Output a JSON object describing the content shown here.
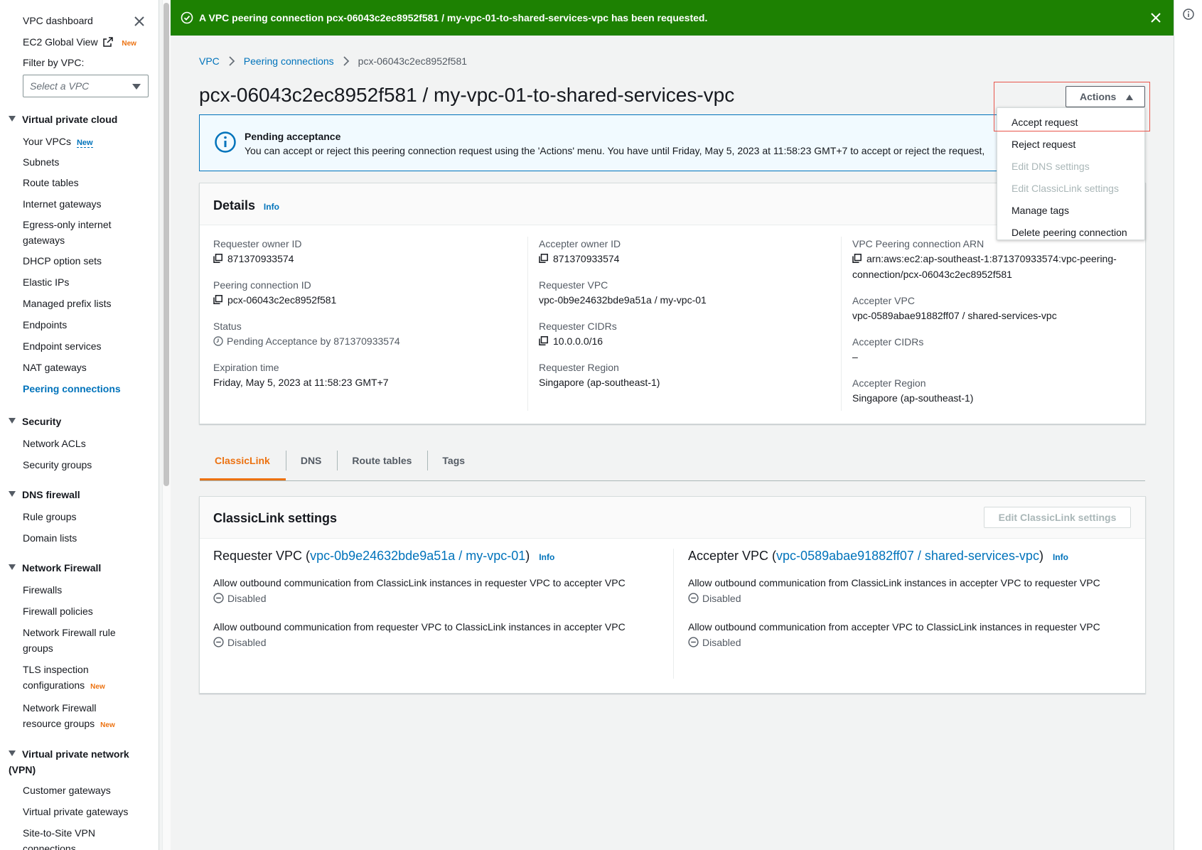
{
  "sidebar": {
    "dashboard": "VPC dashboard",
    "global_view": "EC2 Global View",
    "global_view_badge": "New",
    "filter_label": "Filter by VPC:",
    "filter_placeholder": "Select a VPC",
    "sections": [
      {
        "title": "Virtual private cloud",
        "items": [
          "Your VPCs",
          "Subnets",
          "Route tables",
          "Internet gateways",
          "Egress-only internet gateways",
          "DHCP option sets",
          "Elastic IPs",
          "Managed prefix lists",
          "Endpoints",
          "Endpoint services",
          "NAT gateways",
          "Peering connections"
        ]
      },
      {
        "title": "Security",
        "items": [
          "Network ACLs",
          "Security groups"
        ]
      },
      {
        "title": "DNS firewall",
        "items": [
          "Rule groups",
          "Domain lists"
        ]
      },
      {
        "title": "Network Firewall",
        "items": [
          "Firewalls",
          "Firewall policies",
          "Network Firewall rule groups",
          "TLS inspection configurations",
          "Network Firewall resource groups"
        ]
      },
      {
        "title": "Virtual private network (VPN)",
        "items": [
          "Customer gateways",
          "Virtual private gateways",
          "Site-to-Site VPN connections"
        ]
      }
    ],
    "your_vpcs_badge": "New",
    "tls_badge": "New",
    "resource_groups_badge": "New"
  },
  "flash": {
    "message": "A VPC peering connection pcx-06043c2ec8952f581 / my-vpc-01-to-shared-services-vpc has been requested.",
    "color": "#1d8102"
  },
  "breadcrumb": [
    "VPC",
    "Peering connections",
    "pcx-06043c2ec8952f581"
  ],
  "page_title": "pcx-06043c2ec8952f581 / my-vpc-01-to-shared-services-vpc",
  "actions": {
    "label": "Actions",
    "menu": [
      "Accept request",
      "Reject request",
      "Edit DNS settings",
      "Edit ClassicLink settings",
      "Manage tags",
      "Delete peering connection"
    ]
  },
  "alert": {
    "title": "Pending acceptance",
    "body": "You can accept or reject this peering connection request using the 'Actions' menu. You have until Friday, May 5, 2023 at 11:58:23 GMT+7 to accept or reject the request,"
  },
  "details": {
    "title": "Details",
    "info": "Info",
    "requester_owner_id_label": "Requester owner ID",
    "requester_owner_id": "871370933574",
    "peering_connection_id_label": "Peering connection ID",
    "peering_connection_id": "pcx-06043c2ec8952f581",
    "status_label": "Status",
    "status": "Pending Acceptance by 871370933574",
    "expiration_label": "Expiration time",
    "expiration": "Friday, May 5, 2023 at 11:58:23 GMT+7",
    "accepter_owner_id_label": "Accepter owner ID",
    "accepter_owner_id": "871370933574",
    "requester_vpc_label": "Requester VPC",
    "requester_vpc": "vpc-0b9e24632bde9a51a / my-vpc-01",
    "requester_cidrs_label": "Requester CIDRs",
    "requester_cidrs": "10.0.0.0/16",
    "requester_region_label": "Requester Region",
    "requester_region": "Singapore (ap-southeast-1)",
    "arn_label": "VPC Peering connection ARN",
    "arn_line1": "arn:aws:ec2:ap-southeast-1:871370933574:vpc-peering-",
    "arn_line2": "connection/pcx-06043c2ec8952f581",
    "accepter_vpc_label": "Accepter VPC",
    "accepter_vpc": "vpc-0589abae91882ff07 / shared-services-vpc",
    "accepter_cidrs_label": "Accepter CIDRs",
    "accepter_cidrs": "–",
    "accepter_region_label": "Accepter Region",
    "accepter_region": "Singapore (ap-southeast-1)"
  },
  "tabs": [
    "ClassicLink",
    "DNS",
    "Route tables",
    "Tags"
  ],
  "classiclink": {
    "title": "ClassicLink settings",
    "edit_button": "Edit ClassicLink settings",
    "requester_prefix": "Requester VPC (",
    "requester_vpc": "vpc-0b9e24632bde9a51a / my-vpc-01",
    "accepter_prefix": "Accepter VPC (",
    "accepter_vpc": "vpc-0589abae91882ff07 / shared-services-vpc",
    "close_paren": ")",
    "info": "Info",
    "req_setting_1": "Allow outbound communication from ClassicLink instances in requester VPC to accepter VPC",
    "req_setting_2": "Allow outbound communication from requester VPC to ClassicLink instances in accepter VPC",
    "acc_setting_1": "Allow outbound communication from ClassicLink instances in accepter VPC to requester VPC",
    "acc_setting_2": "Allow outbound communication from accepter VPC to ClassicLink instances in requester VPC",
    "disabled": "Disabled"
  },
  "colors": {
    "link": "#0073bb",
    "accent_orange": "#ec7211",
    "alert_border": "#0073bb",
    "highlight_outline": "#e8554b"
  }
}
